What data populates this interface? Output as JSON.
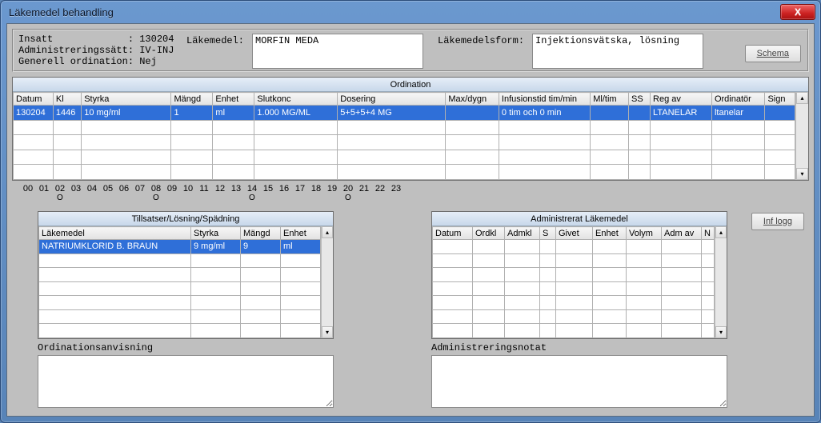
{
  "window": {
    "title": "Läkemedel behandling"
  },
  "close_x": "X",
  "info": {
    "line1": "Insatt             : 130204",
    "line2": "Administreringssätt: IV-INJ",
    "line3": "Generell ordination: Nej",
    "lakemedel_label": "Läkemedel:",
    "lakemedel_value": "MORFIN MEDA",
    "form_label": "Läkemedelsform:",
    "form_value": "Injektionsvätska, lösning",
    "schema_btn": "Schema"
  },
  "ordination": {
    "title": "Ordination",
    "headers": [
      "Datum",
      "Kl",
      "Styrka",
      "Mängd",
      "Enhet",
      "Slutkonc",
      "Dosering",
      "Max/dygn",
      "Infusionstid tim/min",
      "Ml/tim",
      "SS",
      "Reg av",
      "Ordinatör",
      "Sign"
    ],
    "rows": [
      [
        "130204",
        "1446",
        "10 mg/ml",
        "1",
        "ml",
        "1.000 MG/ML",
        "5+5+5+4 MG",
        "",
        "0 tim och 0 min",
        "",
        "",
        "LTANELAR",
        "ltanelar",
        ""
      ]
    ]
  },
  "hours": [
    "00",
    "01",
    "02",
    "03",
    "04",
    "05",
    "06",
    "07",
    "08",
    "09",
    "10",
    "11",
    "12",
    "13",
    "14",
    "15",
    "16",
    "17",
    "18",
    "19",
    "20",
    "21",
    "22",
    "23"
  ],
  "hour_marks": [
    2,
    8,
    14,
    20
  ],
  "mark_char": "O",
  "tillsats": {
    "title": "Tillsatser/Lösning/Spädning",
    "headers": [
      "Läkemedel",
      "Styrka",
      "Mängd",
      "Enhet"
    ],
    "rows": [
      [
        "NATRIUMKLORID B. BRAUN",
        "9 mg/ml",
        "9",
        "ml"
      ]
    ]
  },
  "admin": {
    "title": "Administrerat Läkemedel",
    "headers": [
      "Datum",
      "Ordkl",
      "Admkl",
      "S",
      "Givet",
      "Enhet",
      "Volym",
      "Adm av",
      "N"
    ]
  },
  "inf_logg_btn": "Inf logg",
  "bottom": {
    "ord_label": "Ordinationsanvisning",
    "adm_label": "Administreringsnotat"
  }
}
